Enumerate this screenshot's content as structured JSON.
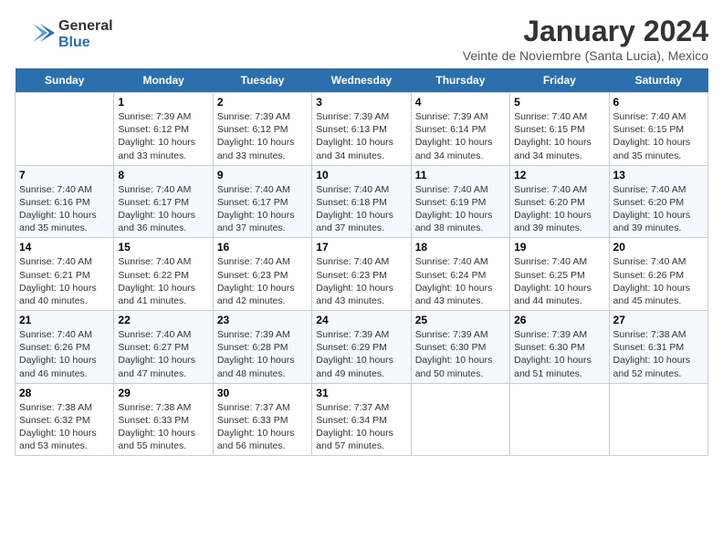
{
  "logo": {
    "general": "General",
    "blue": "Blue"
  },
  "title": "January 2024",
  "subtitle": "Veinte de Noviembre (Santa Lucia), Mexico",
  "days": [
    "Sunday",
    "Monday",
    "Tuesday",
    "Wednesday",
    "Thursday",
    "Friday",
    "Saturday"
  ],
  "weeks": [
    [
      {
        "date": "",
        "lines": []
      },
      {
        "date": "1",
        "lines": [
          "Sunrise: 7:39 AM",
          "Sunset: 6:12 PM",
          "Daylight: 10 hours",
          "and 33 minutes."
        ]
      },
      {
        "date": "2",
        "lines": [
          "Sunrise: 7:39 AM",
          "Sunset: 6:12 PM",
          "Daylight: 10 hours",
          "and 33 minutes."
        ]
      },
      {
        "date": "3",
        "lines": [
          "Sunrise: 7:39 AM",
          "Sunset: 6:13 PM",
          "Daylight: 10 hours",
          "and 34 minutes."
        ]
      },
      {
        "date": "4",
        "lines": [
          "Sunrise: 7:39 AM",
          "Sunset: 6:14 PM",
          "Daylight: 10 hours",
          "and 34 minutes."
        ]
      },
      {
        "date": "5",
        "lines": [
          "Sunrise: 7:40 AM",
          "Sunset: 6:15 PM",
          "Daylight: 10 hours",
          "and 34 minutes."
        ]
      },
      {
        "date": "6",
        "lines": [
          "Sunrise: 7:40 AM",
          "Sunset: 6:15 PM",
          "Daylight: 10 hours",
          "and 35 minutes."
        ]
      }
    ],
    [
      {
        "date": "7",
        "lines": [
          "Sunrise: 7:40 AM",
          "Sunset: 6:16 PM",
          "Daylight: 10 hours",
          "and 35 minutes."
        ]
      },
      {
        "date": "8",
        "lines": [
          "Sunrise: 7:40 AM",
          "Sunset: 6:17 PM",
          "Daylight: 10 hours",
          "and 36 minutes."
        ]
      },
      {
        "date": "9",
        "lines": [
          "Sunrise: 7:40 AM",
          "Sunset: 6:17 PM",
          "Daylight: 10 hours",
          "and 37 minutes."
        ]
      },
      {
        "date": "10",
        "lines": [
          "Sunrise: 7:40 AM",
          "Sunset: 6:18 PM",
          "Daylight: 10 hours",
          "and 37 minutes."
        ]
      },
      {
        "date": "11",
        "lines": [
          "Sunrise: 7:40 AM",
          "Sunset: 6:19 PM",
          "Daylight: 10 hours",
          "and 38 minutes."
        ]
      },
      {
        "date": "12",
        "lines": [
          "Sunrise: 7:40 AM",
          "Sunset: 6:20 PM",
          "Daylight: 10 hours",
          "and 39 minutes."
        ]
      },
      {
        "date": "13",
        "lines": [
          "Sunrise: 7:40 AM",
          "Sunset: 6:20 PM",
          "Daylight: 10 hours",
          "and 39 minutes."
        ]
      }
    ],
    [
      {
        "date": "14",
        "lines": [
          "Sunrise: 7:40 AM",
          "Sunset: 6:21 PM",
          "Daylight: 10 hours",
          "and 40 minutes."
        ]
      },
      {
        "date": "15",
        "lines": [
          "Sunrise: 7:40 AM",
          "Sunset: 6:22 PM",
          "Daylight: 10 hours",
          "and 41 minutes."
        ]
      },
      {
        "date": "16",
        "lines": [
          "Sunrise: 7:40 AM",
          "Sunset: 6:23 PM",
          "Daylight: 10 hours",
          "and 42 minutes."
        ]
      },
      {
        "date": "17",
        "lines": [
          "Sunrise: 7:40 AM",
          "Sunset: 6:23 PM",
          "Daylight: 10 hours",
          "and 43 minutes."
        ]
      },
      {
        "date": "18",
        "lines": [
          "Sunrise: 7:40 AM",
          "Sunset: 6:24 PM",
          "Daylight: 10 hours",
          "and 43 minutes."
        ]
      },
      {
        "date": "19",
        "lines": [
          "Sunrise: 7:40 AM",
          "Sunset: 6:25 PM",
          "Daylight: 10 hours",
          "and 44 minutes."
        ]
      },
      {
        "date": "20",
        "lines": [
          "Sunrise: 7:40 AM",
          "Sunset: 6:26 PM",
          "Daylight: 10 hours",
          "and 45 minutes."
        ]
      }
    ],
    [
      {
        "date": "21",
        "lines": [
          "Sunrise: 7:40 AM",
          "Sunset: 6:26 PM",
          "Daylight: 10 hours",
          "and 46 minutes."
        ]
      },
      {
        "date": "22",
        "lines": [
          "Sunrise: 7:40 AM",
          "Sunset: 6:27 PM",
          "Daylight: 10 hours",
          "and 47 minutes."
        ]
      },
      {
        "date": "23",
        "lines": [
          "Sunrise: 7:39 AM",
          "Sunset: 6:28 PM",
          "Daylight: 10 hours",
          "and 48 minutes."
        ]
      },
      {
        "date": "24",
        "lines": [
          "Sunrise: 7:39 AM",
          "Sunset: 6:29 PM",
          "Daylight: 10 hours",
          "and 49 minutes."
        ]
      },
      {
        "date": "25",
        "lines": [
          "Sunrise: 7:39 AM",
          "Sunset: 6:30 PM",
          "Daylight: 10 hours",
          "and 50 minutes."
        ]
      },
      {
        "date": "26",
        "lines": [
          "Sunrise: 7:39 AM",
          "Sunset: 6:30 PM",
          "Daylight: 10 hours",
          "and 51 minutes."
        ]
      },
      {
        "date": "27",
        "lines": [
          "Sunrise: 7:38 AM",
          "Sunset: 6:31 PM",
          "Daylight: 10 hours",
          "and 52 minutes."
        ]
      }
    ],
    [
      {
        "date": "28",
        "lines": [
          "Sunrise: 7:38 AM",
          "Sunset: 6:32 PM",
          "Daylight: 10 hours",
          "and 53 minutes."
        ]
      },
      {
        "date": "29",
        "lines": [
          "Sunrise: 7:38 AM",
          "Sunset: 6:33 PM",
          "Daylight: 10 hours",
          "and 55 minutes."
        ]
      },
      {
        "date": "30",
        "lines": [
          "Sunrise: 7:37 AM",
          "Sunset: 6:33 PM",
          "Daylight: 10 hours",
          "and 56 minutes."
        ]
      },
      {
        "date": "31",
        "lines": [
          "Sunrise: 7:37 AM",
          "Sunset: 6:34 PM",
          "Daylight: 10 hours",
          "and 57 minutes."
        ]
      },
      {
        "date": "",
        "lines": []
      },
      {
        "date": "",
        "lines": []
      },
      {
        "date": "",
        "lines": []
      }
    ]
  ]
}
